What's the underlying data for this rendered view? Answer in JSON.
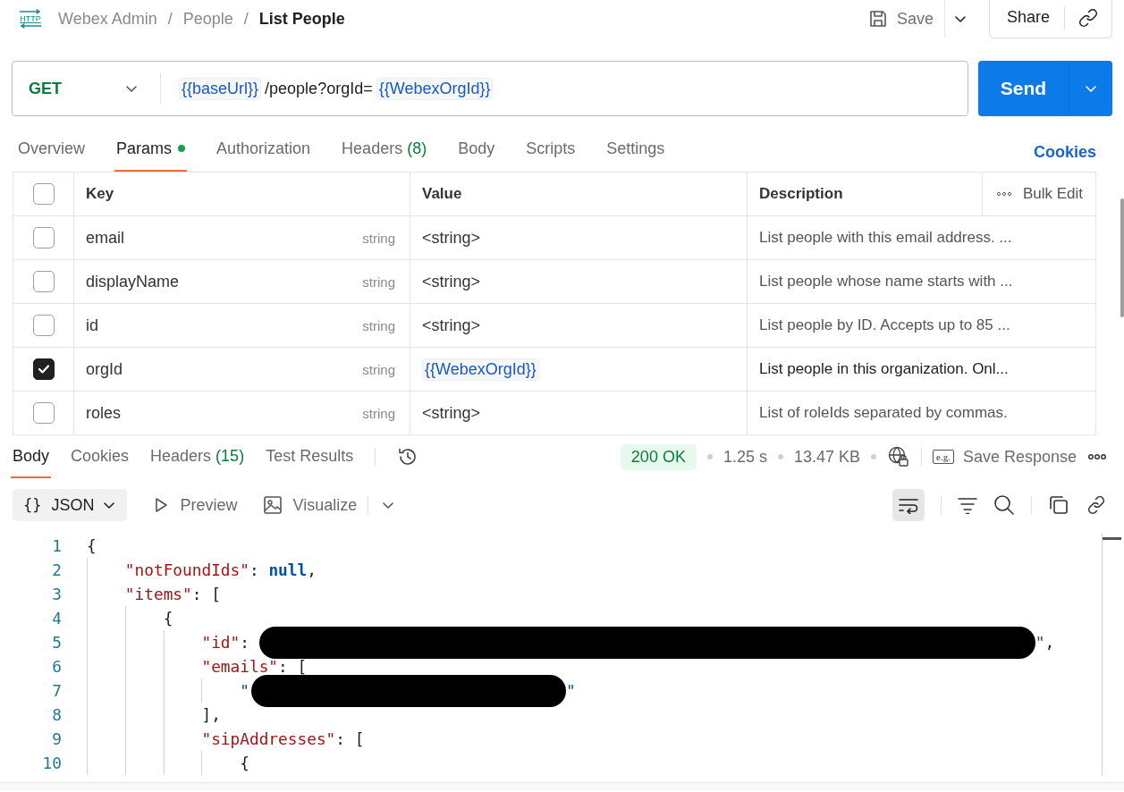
{
  "header": {
    "icon_label": "HTTP",
    "breadcrumb": [
      {
        "text": "Webex Admin",
        "current": false
      },
      {
        "text": "People",
        "current": false
      },
      {
        "text": "List People",
        "current": true
      }
    ],
    "separator": "/",
    "save": "Save",
    "share": "Share"
  },
  "request": {
    "method": "GET",
    "url": [
      {
        "text": "{{baseUrl}}",
        "kind": "variable"
      },
      {
        "text": "/people?orgId=",
        "kind": "text"
      },
      {
        "text": "{{WebexOrgId}}",
        "kind": "variable"
      }
    ],
    "send": "Send"
  },
  "request_tabs": [
    {
      "label": "Overview",
      "selected": false
    },
    {
      "label": "Params",
      "selected": true,
      "dot": true
    },
    {
      "label": "Authorization",
      "selected": false
    },
    {
      "label": "Headers",
      "count": "(8)",
      "selected": false
    },
    {
      "label": "Body",
      "selected": false
    },
    {
      "label": "Scripts",
      "selected": false
    },
    {
      "label": "Settings",
      "selected": false
    }
  ],
  "cookies_link": "Cookies",
  "params": {
    "columns": [
      "Key",
      "Value",
      "Description"
    ],
    "bulk_edit": "Bulk Edit",
    "all_checked": false,
    "rows": [
      {
        "checked": false,
        "key": "email",
        "type": "string",
        "value": {
          "text": "<string>",
          "kind": "text"
        },
        "description": "List people with this email address. ..."
      },
      {
        "checked": false,
        "key": "displayName",
        "type": "string",
        "value": {
          "text": "<string>",
          "kind": "text"
        },
        "description": "List people whose name starts with ..."
      },
      {
        "checked": false,
        "key": "id",
        "type": "string",
        "value": {
          "text": "<string>",
          "kind": "text"
        },
        "description": "List people by ID. Accepts up to 85 ..."
      },
      {
        "checked": true,
        "key": "orgId",
        "type": "string",
        "value": {
          "text": "{{WebexOrgId}}",
          "kind": "variable"
        },
        "description": "List people in this organization. Onl..."
      },
      {
        "checked": false,
        "key": "roles",
        "type": "string",
        "value": {
          "text": "<string>",
          "kind": "text"
        },
        "description": "List of roleIds separated by commas."
      }
    ]
  },
  "response_tabs": [
    {
      "label": "Body",
      "selected": true
    },
    {
      "label": "Cookies",
      "selected": false
    },
    {
      "label": "Headers",
      "count": "(15)",
      "selected": false
    },
    {
      "label": "Test Results",
      "selected": false
    }
  ],
  "response_status": {
    "code": "200 OK",
    "time": "1.25 s",
    "size": "13.47 KB",
    "save_icon_label": "e.g.",
    "save_response": "Save Response"
  },
  "body_toolbar": {
    "format": "JSON",
    "format_icon": "{}",
    "preview": "Preview",
    "visualize": "Visualize",
    "wrap_selected": true
  },
  "code_lines": [
    {
      "number": "1",
      "tokens": [
        {
          "text": "{",
          "kind": "punct"
        }
      ]
    },
    {
      "number": "2",
      "tokens": [
        {
          "text": "    \"notFoundIds\"",
          "kind": "key"
        },
        {
          "text": ": ",
          "kind": "punct"
        },
        {
          "text": "null",
          "kind": "null"
        },
        {
          "text": ",",
          "kind": "punct"
        }
      ]
    },
    {
      "number": "3",
      "tokens": [
        {
          "text": "    \"items\"",
          "kind": "key"
        },
        {
          "text": ": [",
          "kind": "punct"
        }
      ]
    },
    {
      "number": "4",
      "tokens": [
        {
          "text": "        {",
          "kind": "punct"
        }
      ]
    },
    {
      "number": "5",
      "tokens": [
        {
          "text": "            \"id\"",
          "kind": "key"
        },
        {
          "text": ": ",
          "kind": "punct"
        },
        {
          "kind": "redacted-long"
        },
        {
          "text": "\"",
          "kind": "string"
        },
        {
          "text": ",",
          "kind": "punct"
        }
      ]
    },
    {
      "number": "6",
      "tokens": [
        {
          "text": "            \"emails\"",
          "kind": "key"
        },
        {
          "text": ": [",
          "kind": "punct"
        }
      ]
    },
    {
      "number": "7",
      "tokens": [
        {
          "text": "                \"",
          "kind": "string"
        },
        {
          "kind": "redacted-short"
        },
        {
          "text": "\"",
          "kind": "string"
        }
      ]
    },
    {
      "number": "8",
      "tokens": [
        {
          "text": "            ],",
          "kind": "punct"
        }
      ]
    },
    {
      "number": "9",
      "tokens": [
        {
          "text": "            \"sipAddresses\"",
          "kind": "key"
        },
        {
          "text": ": [",
          "kind": "punct"
        }
      ]
    },
    {
      "number": "10",
      "tokens": [
        {
          "text": "                {",
          "kind": "punct"
        }
      ]
    }
  ]
}
